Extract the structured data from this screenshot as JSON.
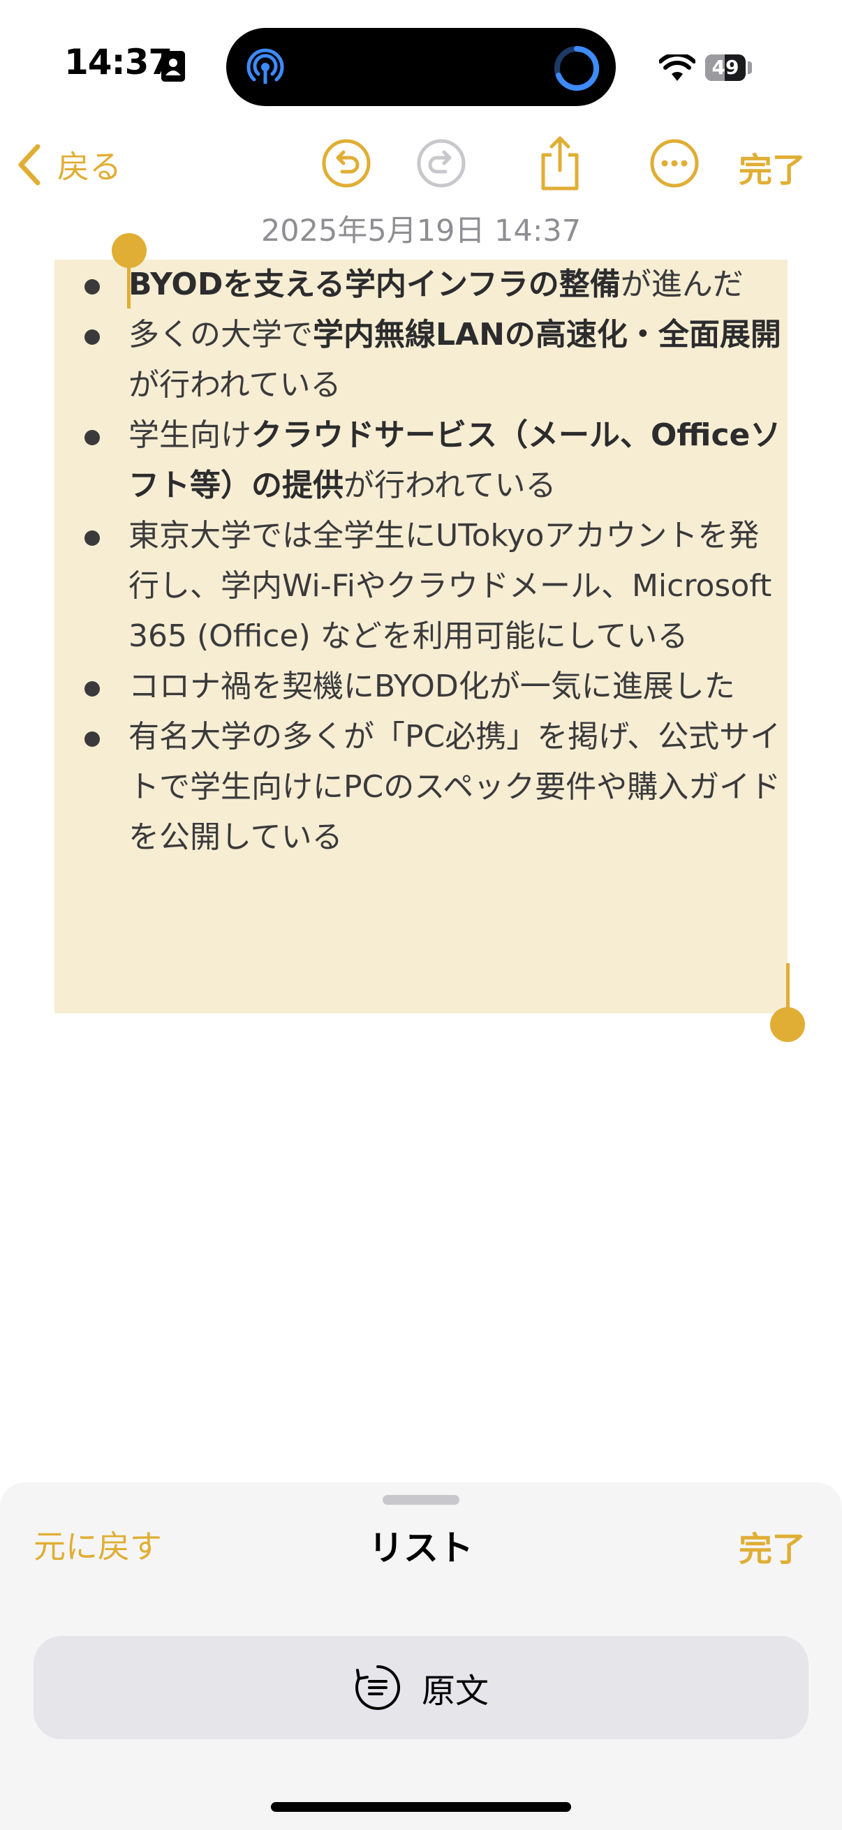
{
  "status_bar": {
    "time": "14:37",
    "battery_level": "49",
    "battery_fraction": 0.49
  },
  "nav": {
    "back_label": "戻る",
    "done_label": "完了"
  },
  "note": {
    "date_line": "2025年5月19日 14:37",
    "items": [
      {
        "bold": "BYODを支える学内インフラの整備",
        "text": "が進んだ"
      },
      {
        "text_before": "多くの大学で",
        "bold": "学内無線LANの高速化・全面展開",
        "text": "が行われている"
      },
      {
        "text_before": "学生向け",
        "bold": "クラウドサービス（メール、Officeソフト等）の提供",
        "text": "が行われている"
      },
      {
        "text": "東京大学では全学生にUTokyoアカウントを発行し、学内Wi-Fiやクラウドメール、Microsoft 365 (Office) などを利用可能にしている"
      },
      {
        "text": "コロナ禍を契機にBYOD化が一気に進展した"
      },
      {
        "text": "有名大学の多くが「PC必携」を掲げ、公式サイトで学生向けにPCのスペック要件や購入ガイドを公開している"
      }
    ]
  },
  "sheet": {
    "revert_label": "元に戻す",
    "title": "リスト",
    "done_label": "完了",
    "original_label": "原文"
  },
  "colors": {
    "accent": "#e0ae35",
    "selection": "#f6edd3"
  },
  "icons": {
    "back": "chevron-left-icon",
    "undo": "undo-icon",
    "redo": "redo-icon",
    "share": "share-icon",
    "more": "more-icon",
    "original": "rewind-text-icon"
  }
}
